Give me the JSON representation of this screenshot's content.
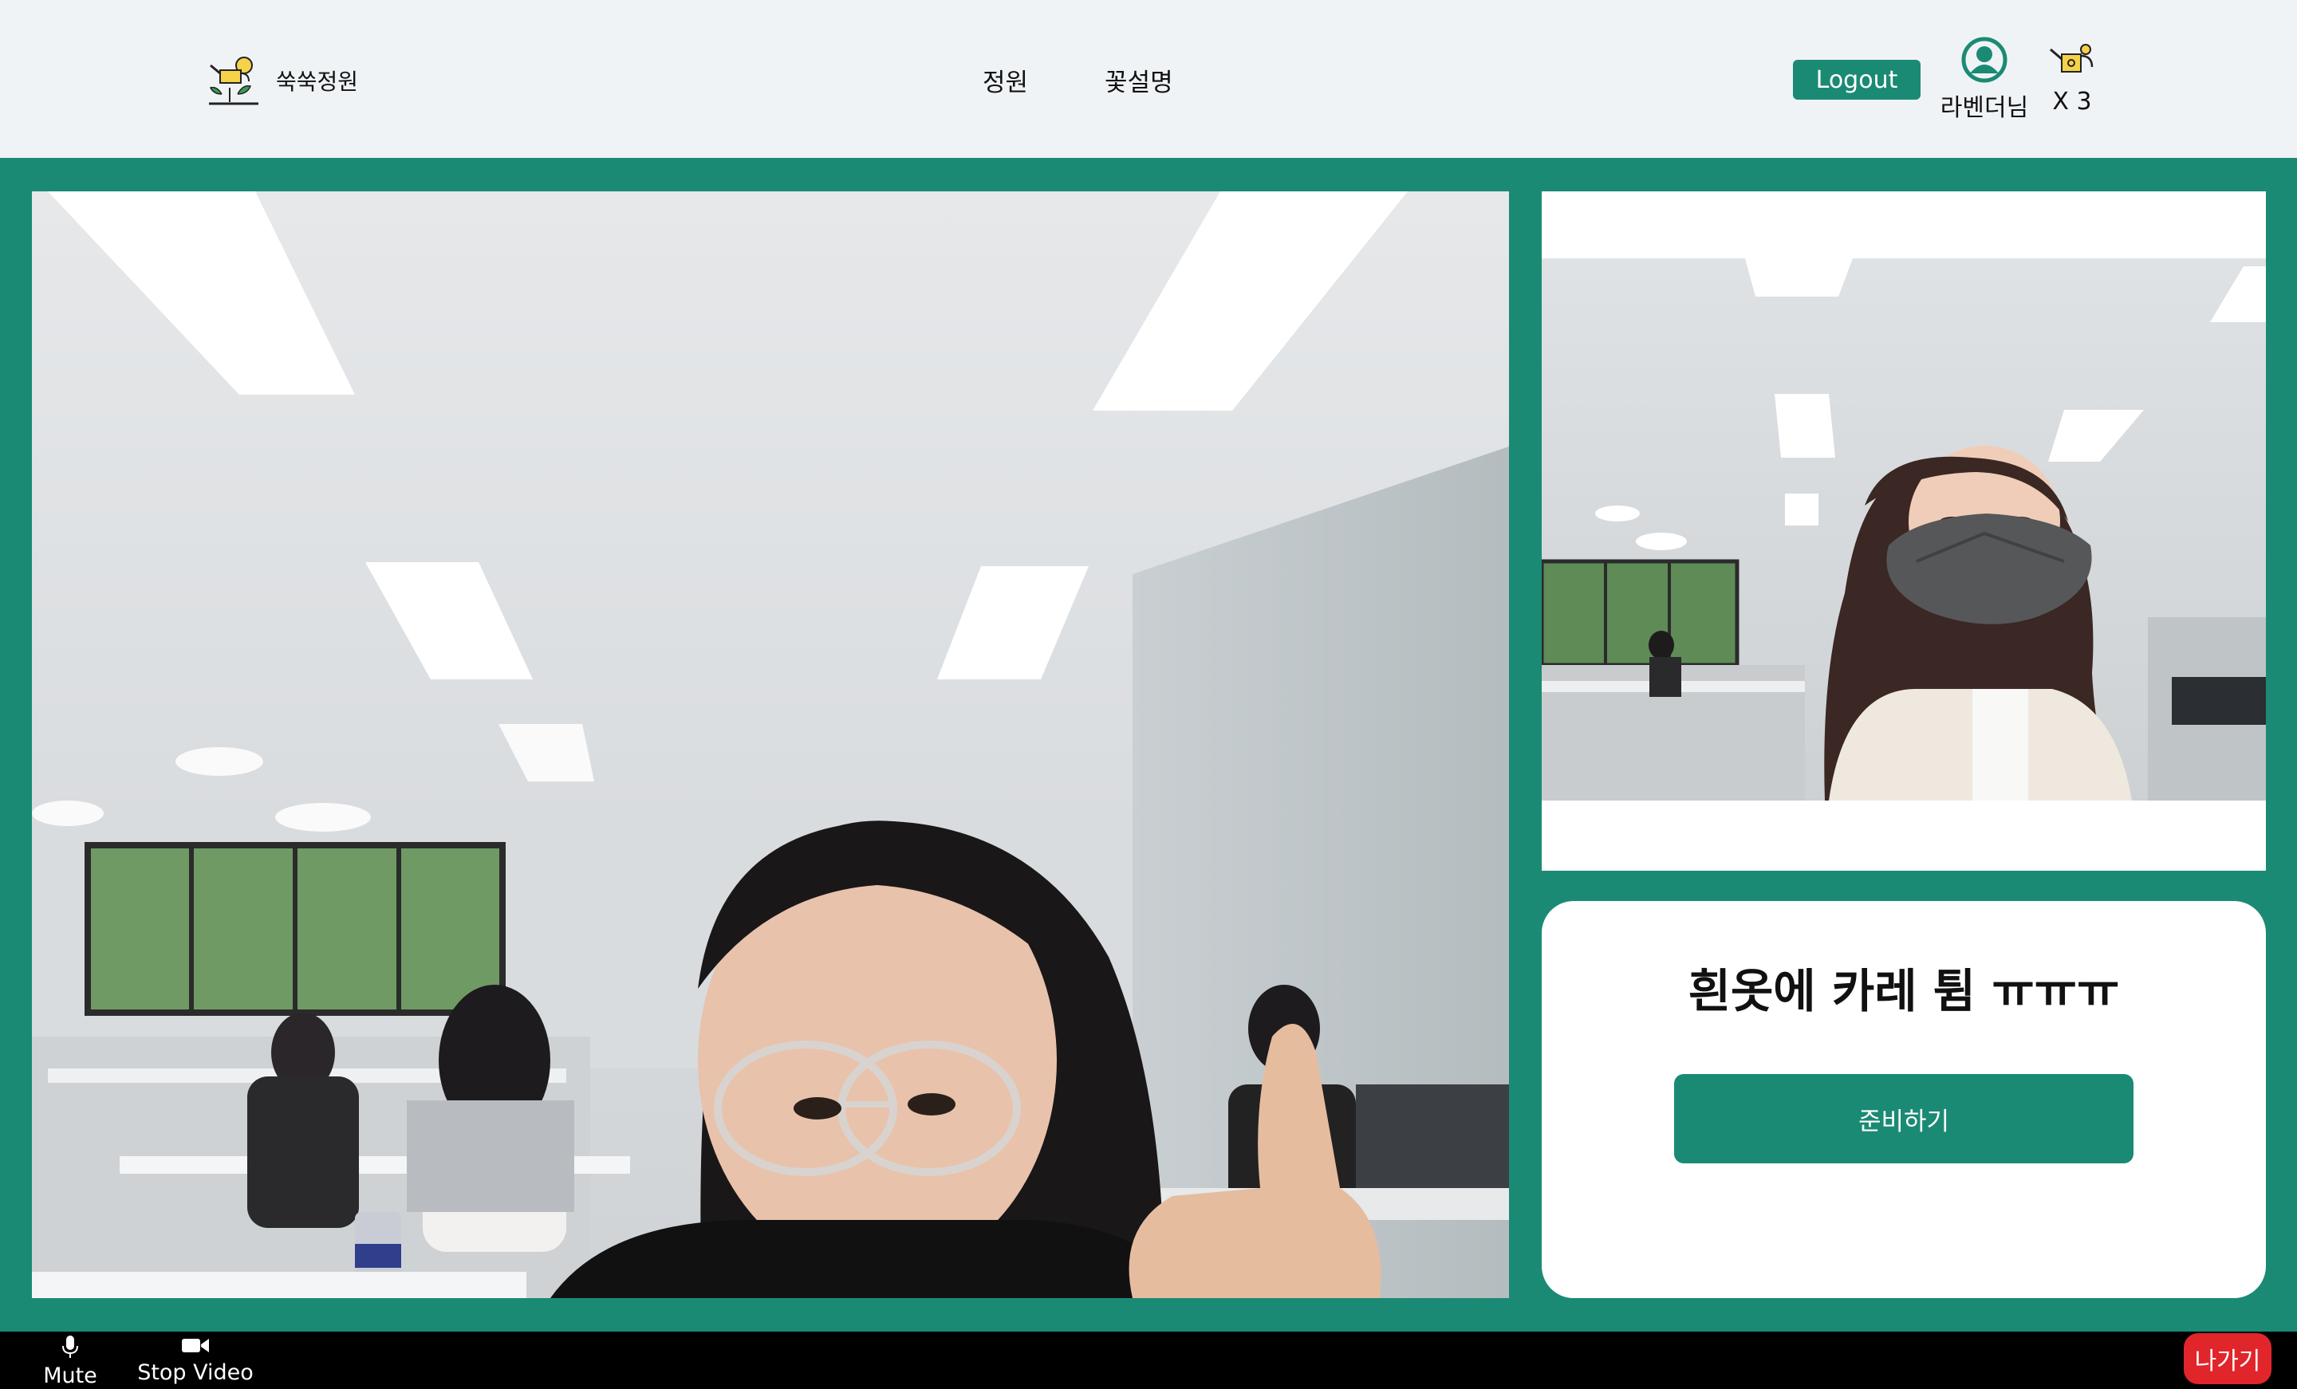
{
  "header": {
    "brand_name": "쑥쑥정원",
    "nav": [
      "정원",
      "꽃설명"
    ],
    "logout_label": "Logout",
    "user_name": "라벤더님",
    "can_count": "X 3",
    "logo_icon": "watering-can-sprout-icon",
    "user_icon": "user-circle-icon",
    "can_icon": "watering-can-icon"
  },
  "topic": {
    "text": "흰옷에 카레 튐 ㅠㅠㅠ",
    "ready_label": "준비하기"
  },
  "controls": {
    "mute_label": "Mute",
    "video_label": "Stop Video",
    "leave_label": "나가기"
  },
  "colors": {
    "brand_green": "#1b8a74",
    "header_bg": "#eff3f6",
    "leave_red": "#e0262b"
  }
}
